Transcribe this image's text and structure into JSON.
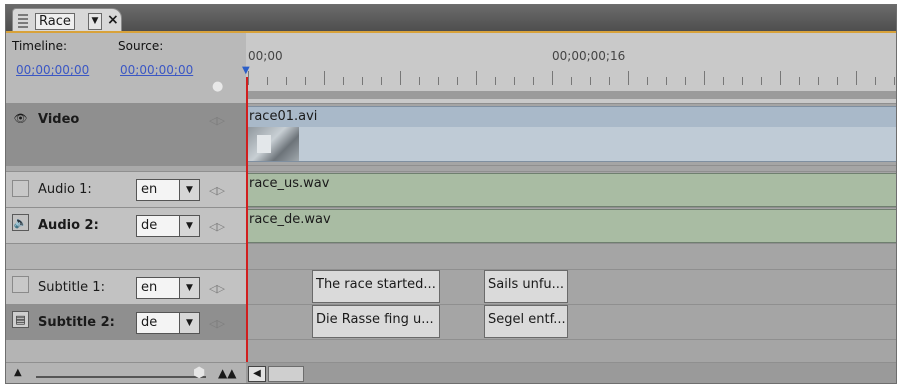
{
  "panel": {
    "tab_title": "Race",
    "tab_menu_glyph": "▼",
    "tab_close_glyph": "×"
  },
  "header": {
    "timeline_label": "Timeline:",
    "source_label": "Source:",
    "timeline_timecode": "00;00;00;00",
    "source_timecode": "00;00;00;00"
  },
  "ruler": {
    "start_label": "00;00",
    "mid_label": "00;00;00;16"
  },
  "tracks": [
    {
      "name": "Video",
      "kind": "video",
      "icon": "eye-icon",
      "clip": "race01.avi"
    },
    {
      "name": "Audio 1:",
      "kind": "audio",
      "language": "en",
      "clip": "race_us.wav"
    },
    {
      "name": "Audio 2:",
      "kind": "audio",
      "icon": "speaker-icon",
      "language": "de",
      "clip": "race_de.wav"
    },
    {
      "name": "Subtitle 1:",
      "kind": "subtitle",
      "language": "en",
      "clips": [
        "The race started...",
        "Sails unfu..."
      ]
    },
    {
      "name": "Subtitle 2:",
      "kind": "subtitle",
      "icon": "subtitle-icon",
      "language": "de",
      "clips": [
        "Die Rasse fing u...",
        "Segel entf..."
      ]
    }
  ],
  "colors": {
    "accent": "#d8a23a",
    "playhead": "#d11e1e",
    "timecode_link": "#3b57c4",
    "video_clip": "#bfcbd6",
    "audio_clip": "#a9bca3"
  }
}
